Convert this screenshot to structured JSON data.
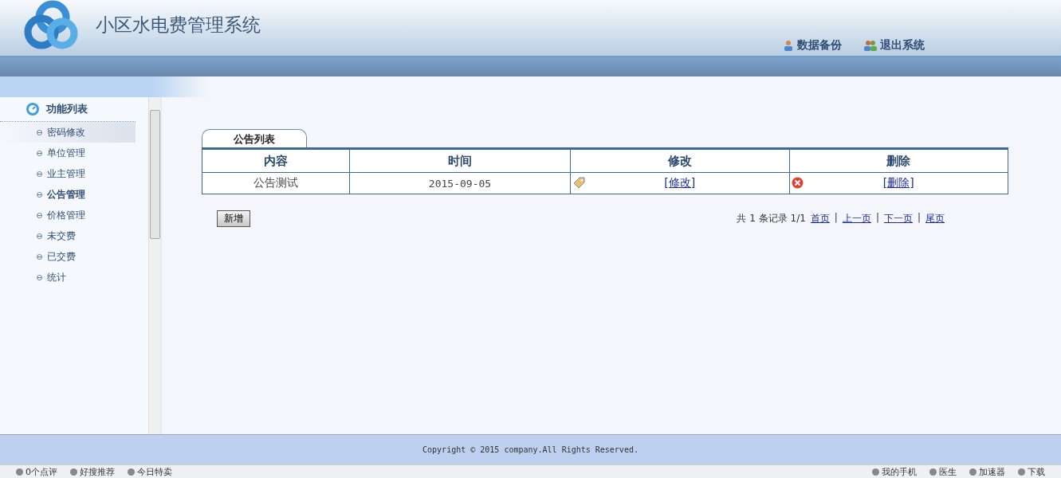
{
  "header": {
    "title": "小区水电费管理系统",
    "actions": [
      {
        "label": "数据备份",
        "kind": "backup"
      },
      {
        "label": "退出系统",
        "kind": "logout"
      }
    ]
  },
  "sidebar": {
    "title": "功能列表",
    "items": [
      {
        "label": "密码修改",
        "selected": false,
        "hovered": true
      },
      {
        "label": "单位管理",
        "selected": false,
        "hovered": false
      },
      {
        "label": "业主管理",
        "selected": false,
        "hovered": false
      },
      {
        "label": "公告管理",
        "selected": true,
        "hovered": false
      },
      {
        "label": "价格管理",
        "selected": false,
        "hovered": false
      },
      {
        "label": "未交费",
        "selected": false,
        "hovered": false
      },
      {
        "label": "已交费",
        "selected": false,
        "hovered": false
      },
      {
        "label": "统计",
        "selected": false,
        "hovered": false
      }
    ]
  },
  "panel": {
    "tab": "公告列表",
    "table": {
      "columns": [
        "内容",
        "时间",
        "修改",
        "删除"
      ],
      "rows": [
        {
          "content": "公告测试",
          "time": "2015-09-05",
          "edit": "[修改]",
          "delete": "[删除]"
        }
      ]
    },
    "add_button": "新增",
    "pagination": {
      "summary": "共 1 条记录 1/1",
      "separator": "|",
      "links": [
        "首页",
        "上一页",
        "下一页",
        "尾页"
      ]
    }
  },
  "footer": {
    "copyright": "Copyright © 2015 company.All Rights Reserved."
  },
  "status_bar": {
    "left": [
      "0个点评",
      "好搜推荐",
      "今日特卖"
    ],
    "right": [
      "我的手机",
      "医生",
      "加速器",
      "下载"
    ]
  }
}
